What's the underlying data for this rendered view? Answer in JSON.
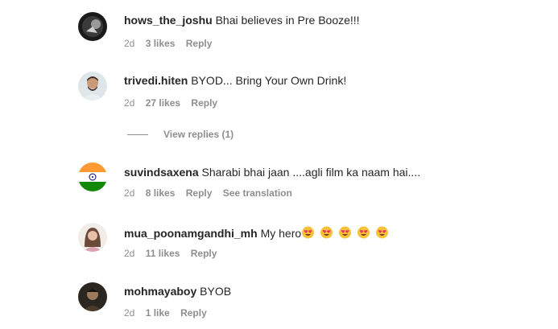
{
  "comments": [
    {
      "username": "hows_the_joshu",
      "text": "Bhai believes in Pre Booze!!!",
      "time": "2d",
      "likes": "3 likes",
      "reply": "Reply",
      "extra": ""
    },
    {
      "username": "trivedi.hiten",
      "text": "BYOD... Bring Your Own Drink!",
      "time": "2d",
      "likes": "27 likes",
      "reply": "Reply",
      "extra": ""
    },
    {
      "username": "suvindsaxena",
      "text": "Sharabi bhai jaan ....agli film ka naam hai....",
      "time": "2d",
      "likes": "8 likes",
      "reply": "Reply",
      "extra": "See translation"
    },
    {
      "username": "mua_poonamgandhi_mh",
      "text": "My hero",
      "time": "2d",
      "likes": "11 likes",
      "reply": "Reply",
      "extra": ""
    },
    {
      "username": "mohmayaboy",
      "text": "BYOB",
      "time": "2d",
      "likes": "1 like",
      "reply": "Reply",
      "extra": ""
    }
  ],
  "view_replies": "View replies (1)",
  "emoji_count": 5,
  "colors": {
    "meta": "#8e8e8e",
    "text": "#262626",
    "emoji": "#f5c33b",
    "heart": "#f0335a"
  }
}
